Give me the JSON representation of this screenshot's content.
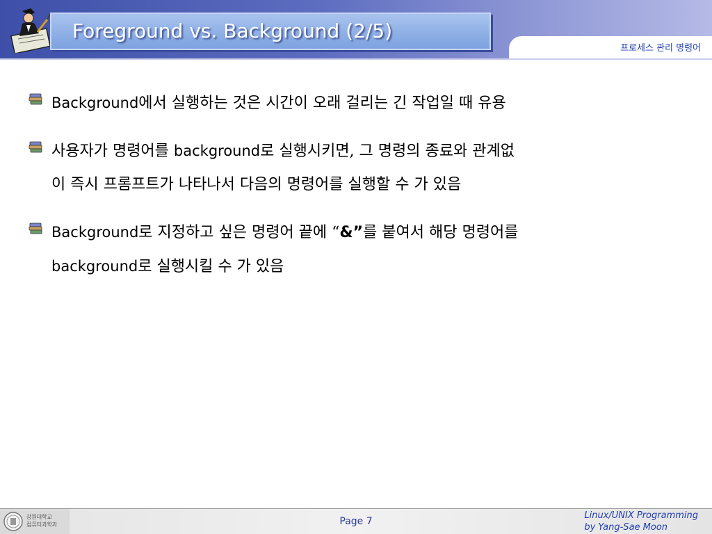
{
  "header": {
    "title": "Foreground vs. Background (2/5)",
    "section": "프로세스 관리 명령어"
  },
  "bullets": [
    {
      "en_prefix": "Background",
      "text": "에서 실행하는 것은 시간이 오래 걸리는 긴 작업일 때 유용"
    },
    {
      "line1_part1": "사용자가 명령어를 ",
      "line1_en": "background",
      "line1_part2": "로 실행시키면, 그 명령의 종료와 관계없",
      "line2": "이 즉시 프롬프트가 나타나서 다음의 명령어를 실행할 수 가 있음"
    },
    {
      "line1_en": "Background",
      "line1_part1": "로 지정하고 싶은 명령어 끝에 “",
      "line1_symbol": "&”",
      "line1_part2": "를 붙여서 해당 명령어를",
      "line2_en": "background",
      "line2_part": "로 실행시킬 수 가 있음"
    }
  ],
  "footer": {
    "univ_line1": "강원대학교",
    "univ_line2": "컴퓨터과학과",
    "page": "Page 7",
    "credit_line1": "Linux/UNIX Programming",
    "credit_line2": "by Yang-Sae Moon"
  },
  "colors": {
    "header_blue": "#3d4fa8",
    "title_box": "#8fb0e6",
    "accent_text": "#1f3fb0"
  },
  "icons": {
    "header_logo": "person-writing-icon",
    "bullet": "book-stack-icon",
    "footer_seal": "university-seal-icon"
  }
}
